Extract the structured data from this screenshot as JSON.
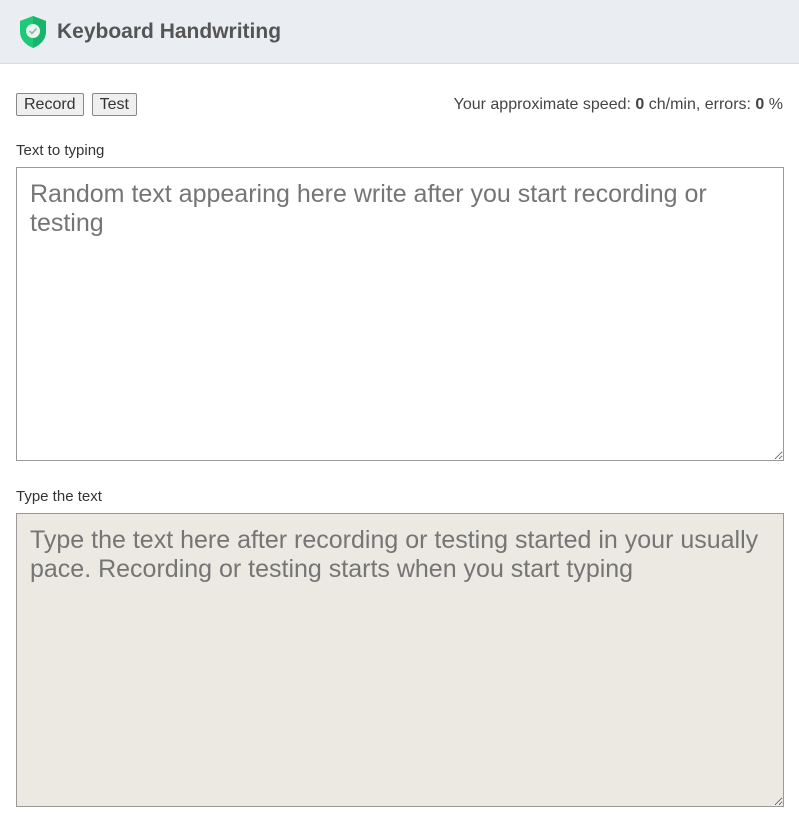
{
  "header": {
    "title": "Keyboard Handwriting",
    "logo_icon": "shield-check-icon",
    "logo_color": "#1ec97a"
  },
  "toolbar": {
    "record_label": "Record",
    "test_label": "Test"
  },
  "stats": {
    "speed_prefix": "Your approximate speed: ",
    "speed": "0",
    "speed_unit": " ch/min, errors: ",
    "errors": "0",
    "errors_unit": " %"
  },
  "source": {
    "label": "Text to typing",
    "placeholder": "Random text appearing here write after you start recording or testing"
  },
  "input": {
    "label": "Type the text",
    "placeholder": "Type the text here after recording or testing started in your usually pace. Recording or testing starts when you start typing"
  }
}
